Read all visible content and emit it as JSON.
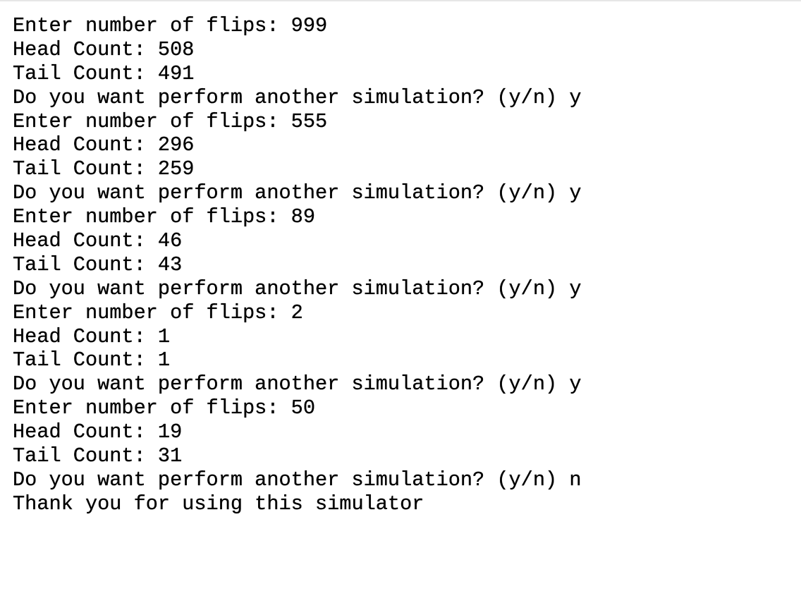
{
  "console": {
    "lines": [
      "Enter number of flips: 999",
      "Head Count: 508",
      "Tail Count: 491",
      "Do you want perform another simulation? (y/n) y",
      "Enter number of flips: 555",
      "Head Count: 296",
      "Tail Count: 259",
      "Do you want perform another simulation? (y/n) y",
      "Enter number of flips: 89",
      "Head Count: 46",
      "Tail Count: 43",
      "Do you want perform another simulation? (y/n) y",
      "Enter number of flips: 2",
      "Head Count: 1",
      "Tail Count: 1",
      "Do you want perform another simulation? (y/n) y",
      "Enter number of flips: 50",
      "Head Count: 19",
      "Tail Count: 31",
      "Do you want perform another simulation? (y/n) n",
      "Thank you for using this simulator"
    ]
  }
}
